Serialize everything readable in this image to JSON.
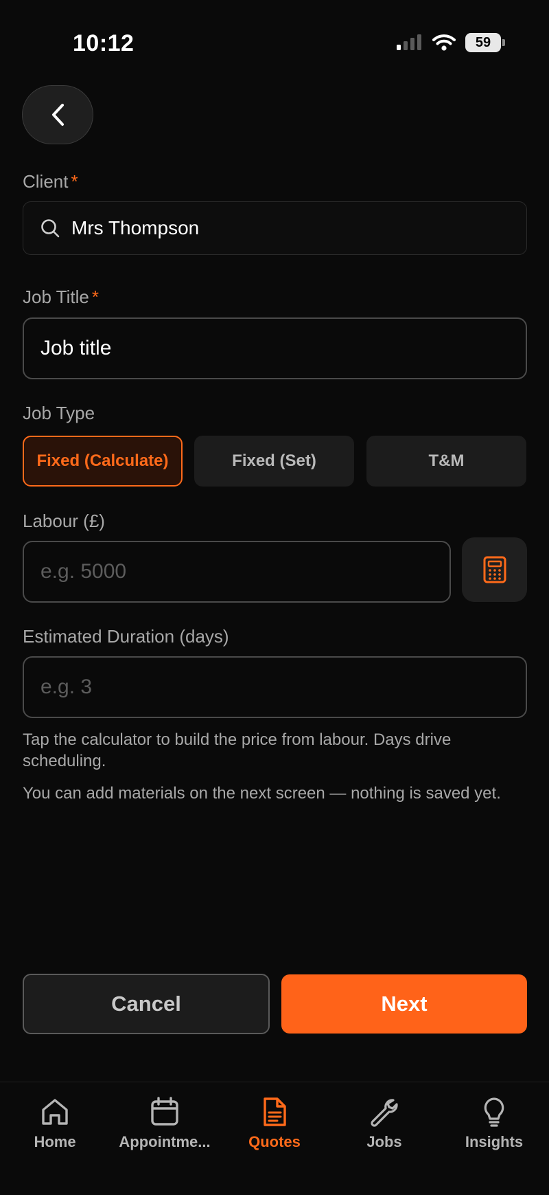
{
  "status": {
    "time": "10:12",
    "battery": "59"
  },
  "form": {
    "client": {
      "label": "Client",
      "required_mark": "*",
      "value": "Mrs Thompson"
    },
    "job_title": {
      "label": "Job Title",
      "required_mark": "*",
      "value": "Job title"
    },
    "job_type": {
      "label": "Job Type",
      "options": [
        "Fixed (Calculate)",
        "Fixed (Set)",
        "T&M"
      ],
      "selected": "Fixed (Calculate)"
    },
    "labour": {
      "label": "Labour (£)",
      "placeholder": "e.g. 5000"
    },
    "duration": {
      "label": "Estimated Duration (days)",
      "placeholder": "e.g. 3"
    },
    "hint_1": "Tap the calculator to build the price from labour. Days drive scheduling.",
    "hint_2": "You can add materials on the next screen — nothing is saved yet."
  },
  "actions": {
    "cancel": "Cancel",
    "next": "Next"
  },
  "tabs": [
    {
      "label": "Home",
      "icon": "home-icon"
    },
    {
      "label": "Appointme...",
      "icon": "calendar-icon"
    },
    {
      "label": "Quotes",
      "icon": "document-icon",
      "active": true
    },
    {
      "label": "Jobs",
      "icon": "wrench-icon"
    },
    {
      "label": "Insights",
      "icon": "lightbulb-icon"
    }
  ],
  "colors": {
    "accent": "#ff6319",
    "background": "#0a0a0a"
  }
}
